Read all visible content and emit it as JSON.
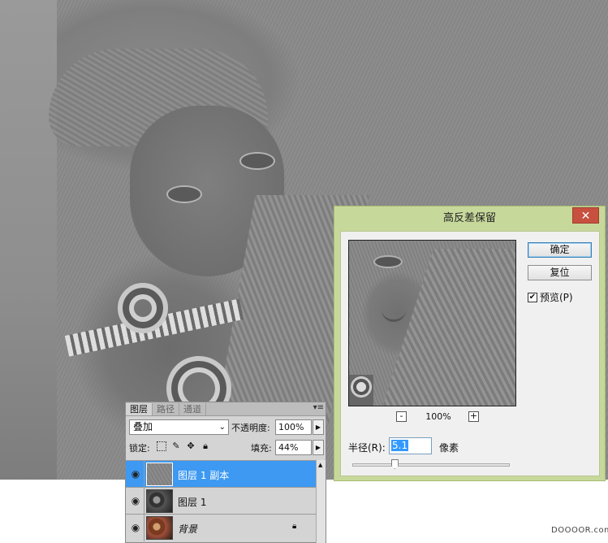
{
  "dialog": {
    "title": "高反差保留",
    "close_glyph": "✕",
    "ok_label": "确定",
    "reset_label": "复位",
    "preview_checked": true,
    "preview_label": "预览(P)",
    "zoom_out_glyph": "-",
    "zoom_in_glyph": "+",
    "zoom_level": "100%",
    "radius_label": "半径(R):",
    "radius_value": "5.1",
    "radius_unit": "像素",
    "radius_slider_fraction": 0.27
  },
  "layers_panel": {
    "tabs": [
      {
        "label": "图层",
        "active": true
      },
      {
        "label": "路径",
        "active": false
      },
      {
        "label": "通道",
        "active": false
      }
    ],
    "menu_glyph": "▾≡",
    "blend_mode": "叠加",
    "opacity_label": "不透明度:",
    "opacity_value": "100%",
    "lock_label": "锁定:",
    "fill_label": "填充:",
    "fill_value": "44%",
    "layers": [
      {
        "name": "图层 1 副本",
        "selected": true,
        "visible": true,
        "locked": false
      },
      {
        "name": "图层 1",
        "selected": false,
        "visible": true,
        "locked": false
      },
      {
        "name": "背景",
        "selected": false,
        "visible": true,
        "locked": true
      }
    ]
  },
  "icons": {
    "eye": "eye-icon",
    "lock": "lock-icon",
    "checkbox": "checkmark-icon"
  },
  "watermark": "DOOOOR.com",
  "colors": {
    "dialog_frame": "#c7d89b",
    "close_button": "#c7503f",
    "selected_layer": "#3d99f2"
  }
}
